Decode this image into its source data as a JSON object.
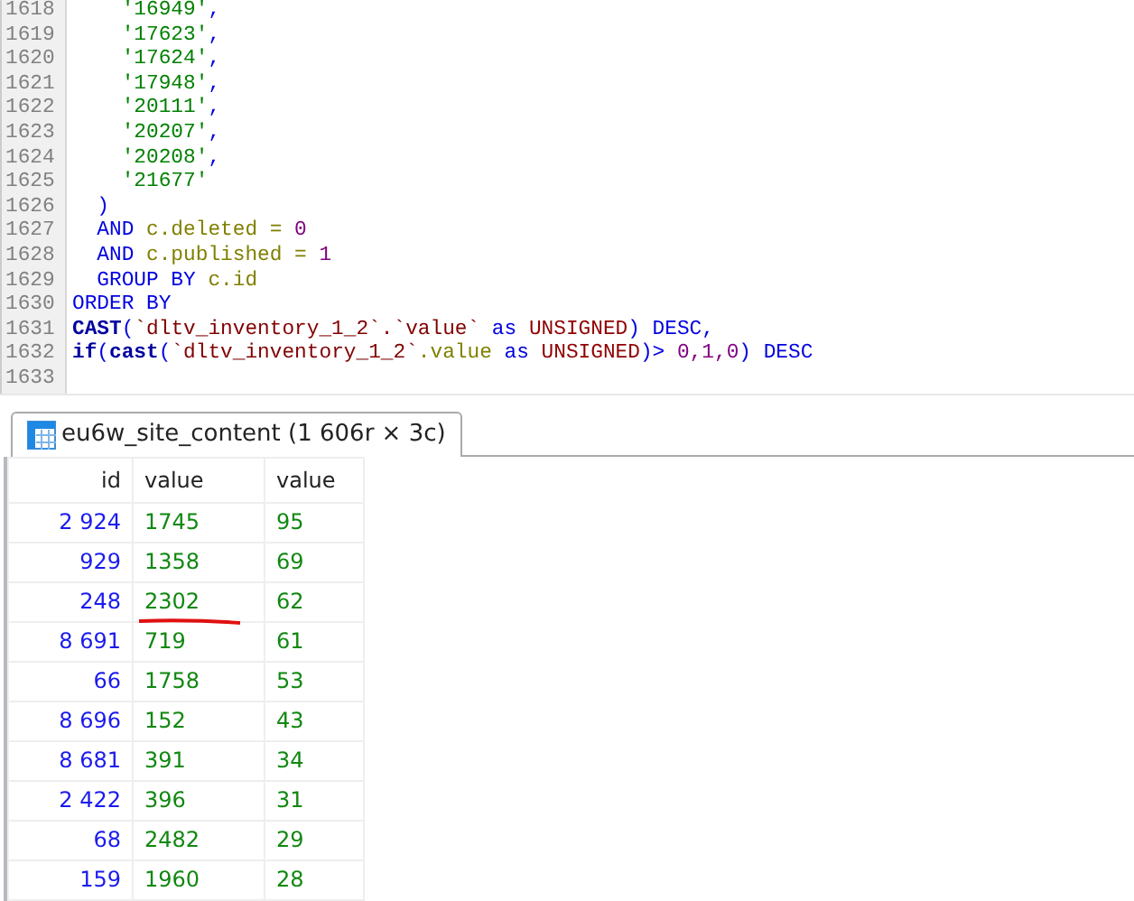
{
  "editor": {
    "lines": [
      {
        "number": "1618",
        "tokens": [
          {
            "text": "    '16949'",
            "kind": "string"
          },
          {
            "text": ",",
            "kind": "punct"
          }
        ]
      },
      {
        "number": "1619",
        "tokens": [
          {
            "text": "    '17623'",
            "kind": "string"
          },
          {
            "text": ",",
            "kind": "punct"
          }
        ]
      },
      {
        "number": "1620",
        "tokens": [
          {
            "text": "    '17624'",
            "kind": "string"
          },
          {
            "text": ",",
            "kind": "punct"
          }
        ]
      },
      {
        "number": "1621",
        "tokens": [
          {
            "text": "    '17948'",
            "kind": "string"
          },
          {
            "text": ",",
            "kind": "punct"
          }
        ]
      },
      {
        "number": "1622",
        "tokens": [
          {
            "text": "    '20111'",
            "kind": "string"
          },
          {
            "text": ",",
            "kind": "punct"
          }
        ]
      },
      {
        "number": "1623",
        "tokens": [
          {
            "text": "    '20207'",
            "kind": "string"
          },
          {
            "text": ",",
            "kind": "punct"
          }
        ]
      },
      {
        "number": "1624",
        "tokens": [
          {
            "text": "    '20208'",
            "kind": "string"
          },
          {
            "text": ",",
            "kind": "punct"
          }
        ]
      },
      {
        "number": "1625",
        "tokens": [
          {
            "text": "    '21677'",
            "kind": "string"
          }
        ]
      },
      {
        "number": "1626",
        "tokens": [
          {
            "text": "  )",
            "kind": "punct"
          }
        ]
      },
      {
        "number": "1627",
        "tokens": [
          {
            "text": "  AND ",
            "kind": "keyword"
          },
          {
            "text": "c.deleted = ",
            "kind": "ident"
          },
          {
            "text": "0",
            "kind": "number"
          }
        ]
      },
      {
        "number": "1628",
        "tokens": [
          {
            "text": "  AND ",
            "kind": "keyword"
          },
          {
            "text": "c.published = ",
            "kind": "ident"
          },
          {
            "text": "1",
            "kind": "number"
          }
        ]
      },
      {
        "number": "1629",
        "tokens": [
          {
            "text": "  GROUP BY ",
            "kind": "keyword"
          },
          {
            "text": "c.id",
            "kind": "ident"
          }
        ]
      },
      {
        "number": "1630",
        "tokens": [
          {
            "text": "ORDER BY",
            "kind": "keyword"
          }
        ]
      },
      {
        "number": "1631",
        "tokens": [
          {
            "text": "CAST",
            "kind": "func"
          },
          {
            "text": "(",
            "kind": "punct"
          },
          {
            "text": "`dltv_inventory_1_2`.`value`",
            "kind": "quoted"
          },
          {
            "text": " as ",
            "kind": "keyword"
          },
          {
            "text": "UNSIGNED",
            "kind": "type"
          },
          {
            "text": ") DESC,",
            "kind": "punct"
          }
        ]
      },
      {
        "number": "1632",
        "tokens": [
          {
            "text": "if",
            "kind": "func"
          },
          {
            "text": "(",
            "kind": "punct"
          },
          {
            "text": "cast",
            "kind": "func"
          },
          {
            "text": "(",
            "kind": "punct"
          },
          {
            "text": "`dltv_inventory_1_2`",
            "kind": "quoted"
          },
          {
            "text": ".value",
            "kind": "ident"
          },
          {
            "text": " as ",
            "kind": "keyword"
          },
          {
            "text": "UNSIGNED",
            "kind": "type"
          },
          {
            "text": ")> ",
            "kind": "punct"
          },
          {
            "text": "0,1,0",
            "kind": "number"
          },
          {
            "text": ") DESC",
            "kind": "punct"
          }
        ]
      },
      {
        "number": "1633"
      }
    ]
  },
  "result_tab": {
    "label": "eu6w_site_content (1 606r × 3c)"
  },
  "table": {
    "columns": [
      "id",
      "value",
      "value"
    ],
    "rows": [
      {
        "cells": [
          "2 924",
          "1745",
          "95"
        ],
        "underlined": false
      },
      {
        "cells": [
          "929",
          "1358",
          "69"
        ],
        "underlined": false
      },
      {
        "cells": [
          "248",
          "2302",
          "62"
        ],
        "underlined": true
      },
      {
        "cells": [
          "8 691",
          "719",
          "61"
        ],
        "underlined": false
      },
      {
        "cells": [
          "66",
          "1758",
          "53"
        ],
        "underlined": false
      },
      {
        "cells": [
          "8 696",
          "152",
          "43"
        ],
        "underlined": false
      },
      {
        "cells": [
          "8 681",
          "391",
          "34"
        ],
        "underlined": false
      },
      {
        "cells": [
          "2 422",
          "396",
          "31"
        ],
        "underlined": false
      },
      {
        "cells": [
          "68",
          "2482",
          "29"
        ],
        "underlined": false
      },
      {
        "cells": [
          "159",
          "1960",
          "28"
        ],
        "underlined": false
      }
    ]
  }
}
